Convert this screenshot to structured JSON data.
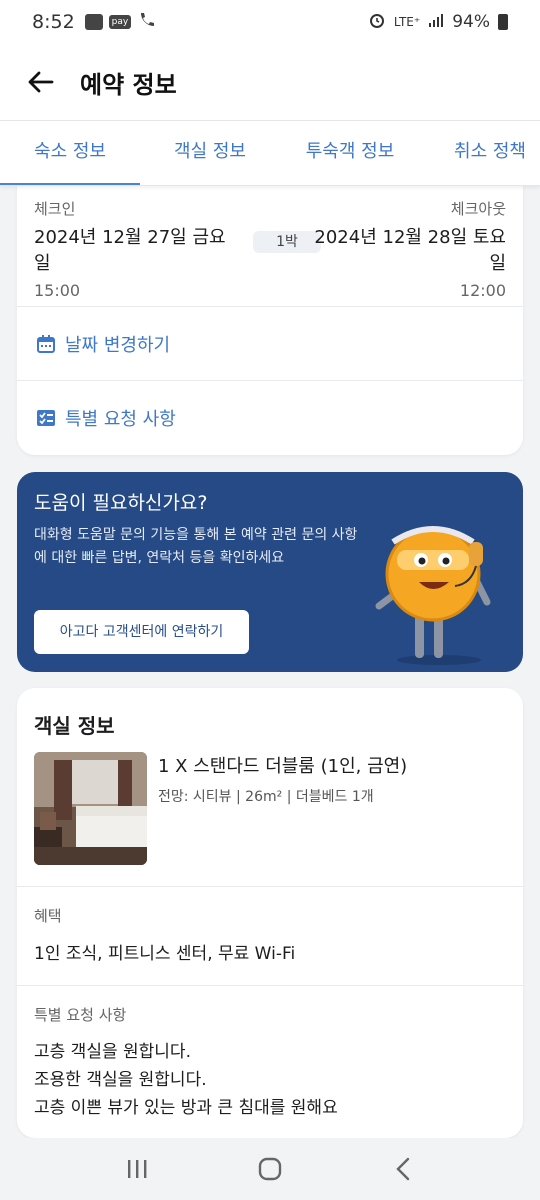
{
  "status_bar": {
    "time": "8:52",
    "pay_label": "pay",
    "network": "LTE⁺",
    "battery": "94%"
  },
  "header": {
    "title": "예약 정보"
  },
  "tabs": [
    {
      "label": "숙소 정보",
      "active": true
    },
    {
      "label": "객실 정보",
      "active": false
    },
    {
      "label": "투숙객 정보",
      "active": false
    },
    {
      "label": "취소 정책",
      "active": false
    }
  ],
  "dates": {
    "checkin_label": "체크인",
    "checkin_date": "2024년 12월 27일 금요일",
    "checkin_time": "15:00",
    "nights": "1박",
    "checkout_label": "체크아웃",
    "checkout_date": "2024년 12월 28일 토요일",
    "checkout_time": "12:00"
  },
  "actions": {
    "change_dates": "날짜 변경하기",
    "special_request": "특별 요청 사항"
  },
  "help": {
    "title": "도움이 필요하신가요?",
    "text": "대화형 도움말 문의 기능을 통해 본 예약 관련 문의 사항에 대한 빠른 답변, 연락처 등을 확인하세요",
    "button": "아고다 고객센터에 연락하기"
  },
  "room": {
    "section_title": "객실 정보",
    "name": "1 X 스탠다드 더블룸 (1인, 금연)",
    "detail": "전망: 시티뷰 | 26m² | 더블베드 1개",
    "benefits_label": "혜택",
    "benefits": "1인 조식, 피트니스 센터, 무료 Wi-Fi",
    "special_label": "특별 요청 사항",
    "requests": [
      "고층 객실을 원합니다.",
      "조용한 객실을 원합니다.",
      "고층 이쁜 뷰가 있는 방과 큰 침대를 원해요"
    ]
  },
  "colors": {
    "accent": "#3f78c9",
    "help_bg": "#254a85"
  }
}
